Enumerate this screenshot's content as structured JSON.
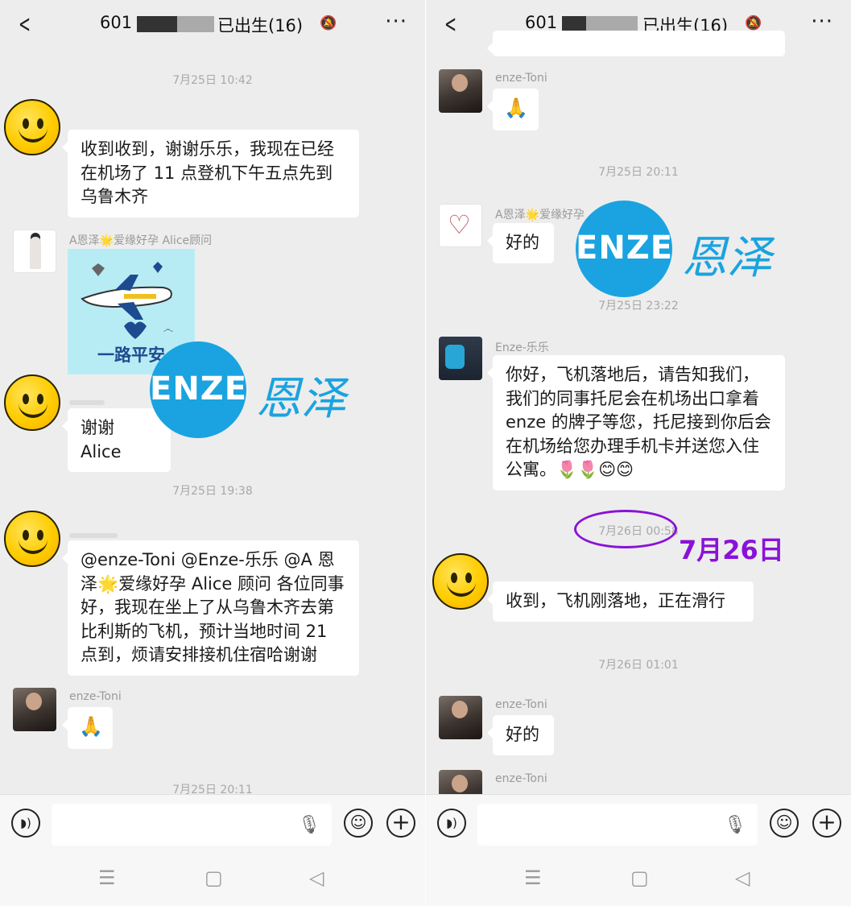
{
  "left": {
    "header": {
      "back": "<",
      "number": "601",
      "name": "已出生(16)",
      "more": "···"
    },
    "messages": {
      "ts1": "7月25日 10:42",
      "m1": "收到收到，谢谢乐乐，我现在已经在机场了 11 点登机下午五点先到乌鲁木齐",
      "alice_sender": "A恩泽🌟爱缘好孕 Alice顾问",
      "sticker_caption": "一路平安",
      "m2": "谢谢 Alice",
      "ts2": "7月25日 19:38",
      "m3": "@enze-Toni @Enze-乐乐 @A 恩泽🌟爱缘好孕 Alice 顾问 各位同事好，我现在坐上了从乌鲁木齐去第比利斯的飞机，预计当地时间 21 点到，烦请安排接机住宿哈谢谢",
      "toni_sender": "enze-Toni",
      "toni_msg": "🙏",
      "ts3": "7月25日 20:11"
    }
  },
  "right": {
    "header": {
      "back": "<",
      "number": "601",
      "name": "已出生(16)",
      "more": "···"
    },
    "messages": {
      "toni_sender": "enze-Toni",
      "toni_msg": "🙏",
      "ts1": "7月25日 20:11",
      "aiyuan_sender": "A恩泽🌟爱缘好孕",
      "aiyuan_msg": "好的",
      "ts2": "7月25日 23:22",
      "lele_sender": "Enze-乐乐",
      "lele_msg": "你好，飞机落地后，请告知我们，我们的同事托尼会在机场出口拿着 enze 的牌子等您，托尼接到你后会在机场给您办理手机卡并送您入住公寓。🌷🌷😊😊",
      "ts3": "7月26日 00:58",
      "overlay_date": "7月26日",
      "m_landing": "收到，飞机刚落地，正在滑行",
      "ts4": "7月26日 01:01",
      "toni2_sender": "enze-Toni",
      "toni2_msg": "好的",
      "toni3_sender": "enze-Toni"
    }
  },
  "watermark": {
    "brand": "ENZE",
    "chinese": "恩泽"
  },
  "input_bar": {
    "voice_icon": "voice-icon",
    "mic_icon": "mic-icon",
    "emoji_icon": "emoji-icon",
    "plus_icon": "plus-icon"
  },
  "nav_bar": {
    "menu": "☰",
    "home": "▢",
    "back": "◁"
  },
  "colors": {
    "bg": "#ededed",
    "bubble": "#ffffff",
    "brand_blue": "#1aa3e0",
    "annotation_purple": "#8a12d8"
  }
}
